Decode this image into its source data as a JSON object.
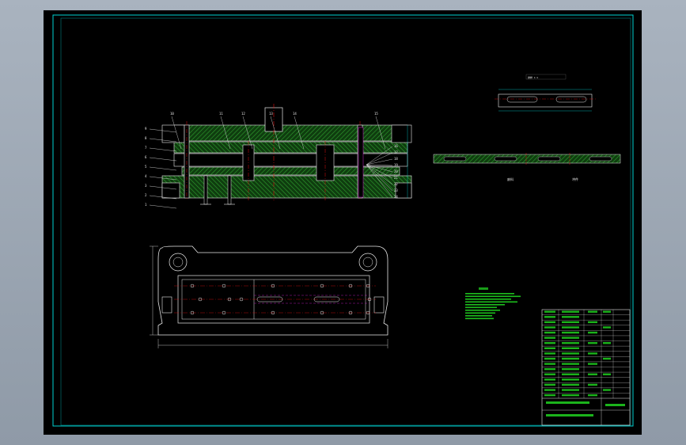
{
  "drawing": {
    "background": "#000000",
    "border_color": "#00d2d2",
    "outline_color": "#e8e8e8",
    "centerline_color": "#e01010",
    "hatch_color": "#2a8a2a",
    "notes_color": "#22e022",
    "part_labels_left": [
      "9",
      "8",
      "7",
      "6",
      "5",
      "4",
      "3",
      "2",
      "1"
    ],
    "part_labels_top": [
      "10",
      "11",
      "12",
      "13",
      "14",
      "15"
    ],
    "part_labels_right": [
      "16",
      "17",
      "18",
      "19",
      "20",
      "21",
      "22",
      "23",
      "24"
    ],
    "strip_labels": [
      "废料",
      "冲件"
    ]
  },
  "title_block": {
    "rows": 17
  }
}
